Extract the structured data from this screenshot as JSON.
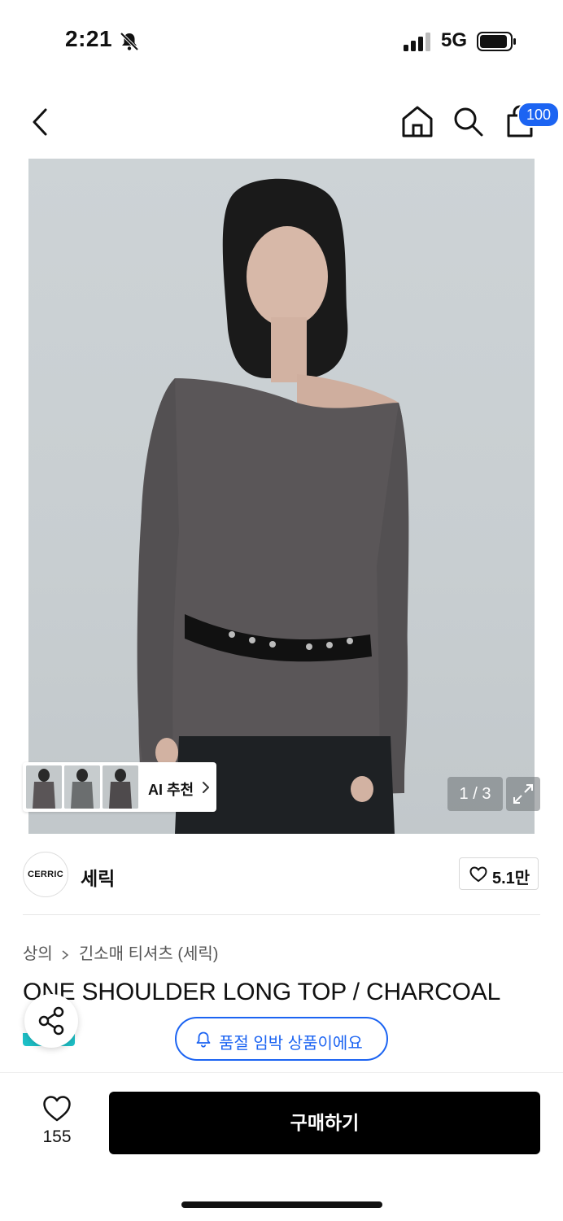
{
  "status_bar": {
    "time": "2:21",
    "network": "5G",
    "icons": [
      "bell-slash-icon",
      "signal-icon",
      "battery-icon"
    ]
  },
  "nav": {
    "icons": [
      "back-arrow-icon",
      "home-icon",
      "search-icon",
      "cart-icon"
    ],
    "cart_badge": "100"
  },
  "gallery": {
    "counter": "1 / 3",
    "ai_recommend_label": "AI 추천",
    "expand_icon": "expand-icon"
  },
  "brand": {
    "logo_text": "CERRIC",
    "name": "세릭",
    "like_count": "5.1만"
  },
  "breadcrumb": [
    "상의",
    "긴소매 티셔츠 (세릭)"
  ],
  "product": {
    "title": "ONE SHOULDER LONG TOP / CHARCOAL"
  },
  "soldout_notice": "품절 임박 상품이에요",
  "bottom_bar": {
    "wish_count": "155",
    "buy_label": "구매하기"
  },
  "colors": {
    "accent_blue": "#1c64f2",
    "buy_button": "#000000",
    "teal": "#1ec0c7"
  }
}
